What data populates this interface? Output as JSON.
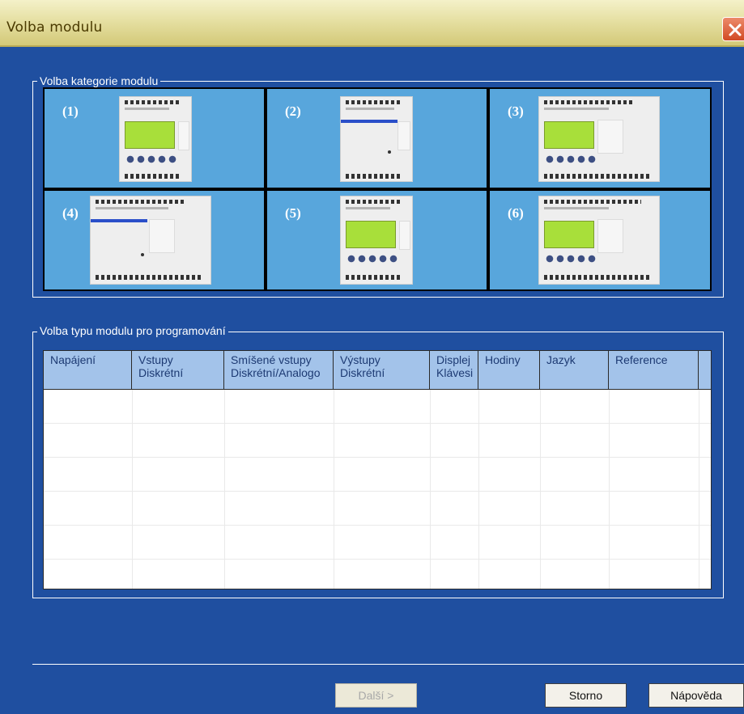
{
  "window": {
    "title": "Volba modulu",
    "close_icon": "close-icon"
  },
  "category_group": {
    "label": "Volba kategorie modulu",
    "tiles": [
      {
        "label": "(1)"
      },
      {
        "label": "(2)"
      },
      {
        "label": "(3)"
      },
      {
        "label": "(4)"
      },
      {
        "label": "(5)"
      },
      {
        "label": "(6)"
      }
    ]
  },
  "type_group": {
    "label": "Volba typu modulu pro programování",
    "columns": [
      {
        "line1": "Napájení",
        "line2": ""
      },
      {
        "line1": "Vstupy",
        "line2": "Diskrétní"
      },
      {
        "line1": "Smíšené vstupy",
        "line2": "Diskrétní/Analogo"
      },
      {
        "line1": "Výstupy",
        "line2": "Diskrétní"
      },
      {
        "line1": "Displej",
        "line2": "Klávesi"
      },
      {
        "line1": "Hodiny",
        "line2": ""
      },
      {
        "line1": "Jazyk",
        "line2": ""
      },
      {
        "line1": "Reference",
        "line2": ""
      },
      {
        "line1": "",
        "line2": ""
      }
    ],
    "rows": []
  },
  "buttons": {
    "next": "Další >",
    "cancel": "Storno",
    "help": "Nápověda"
  },
  "colors": {
    "dialog_background": "#1f4fa0",
    "tile_background": "#58a6dc",
    "header_background": "#a3c3ea",
    "lcd_green": "#a8df3a"
  }
}
